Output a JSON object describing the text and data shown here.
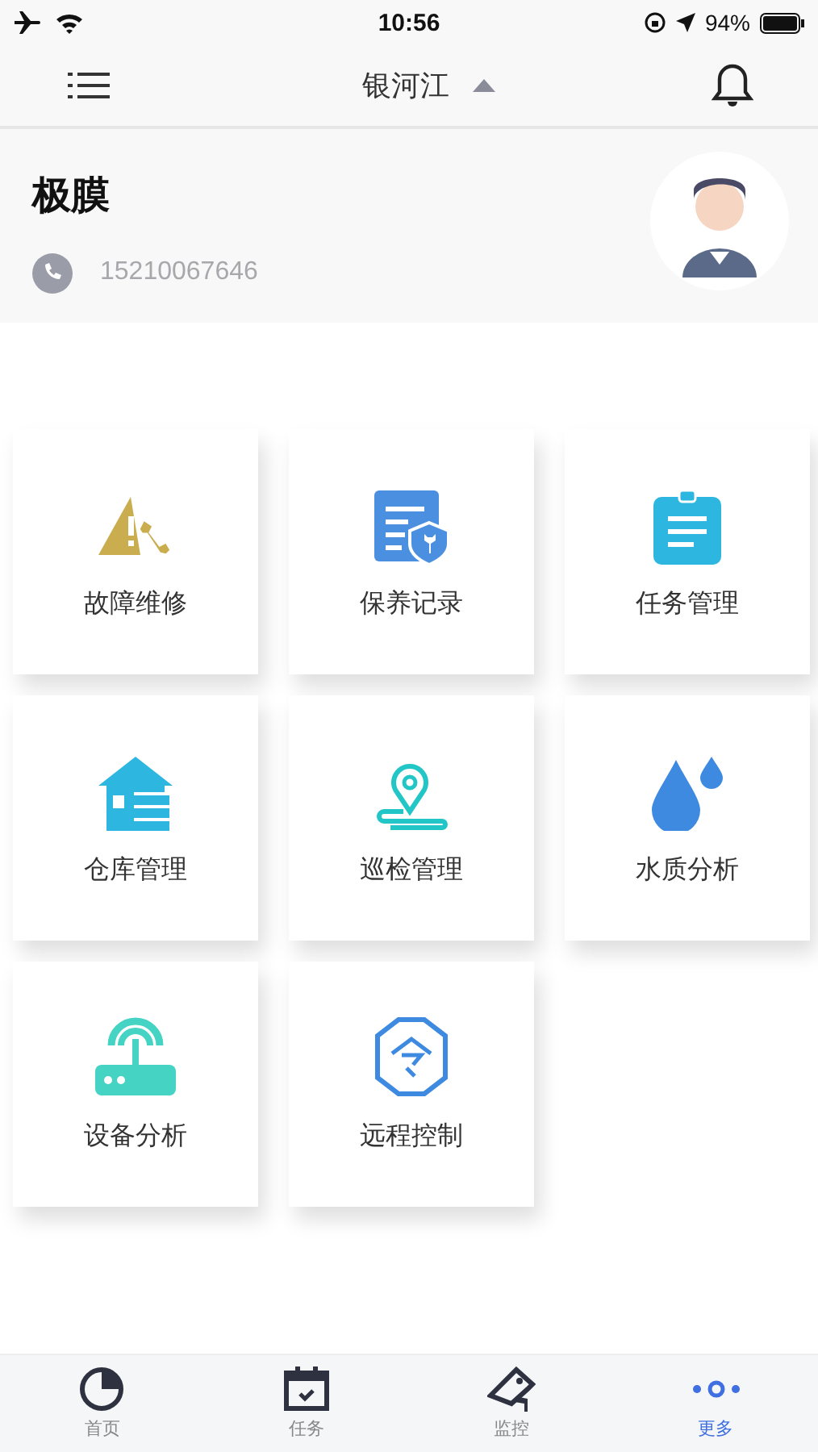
{
  "status_bar": {
    "time": "10:56",
    "battery": "94%"
  },
  "nav": {
    "title": "银河江"
  },
  "profile": {
    "name": "极膜",
    "phone": "15210067646"
  },
  "tiles": [
    {
      "label": "故障维修",
      "kind": "repair"
    },
    {
      "label": "保养记录",
      "kind": "maintenance"
    },
    {
      "label": "任务管理",
      "kind": "clipboard"
    },
    {
      "label": "仓库管理",
      "kind": "warehouse"
    },
    {
      "label": "巡检管理",
      "kind": "location"
    },
    {
      "label": "水质分析",
      "kind": "water"
    },
    {
      "label": "设备分析",
      "kind": "router"
    },
    {
      "label": "远程控制",
      "kind": "command"
    }
  ],
  "tab_bar": [
    {
      "label": "首页",
      "kind": "pie",
      "selected": false
    },
    {
      "label": "任务",
      "kind": "calendar",
      "selected": false
    },
    {
      "label": "监控",
      "kind": "camera",
      "selected": false
    },
    {
      "label": "更多",
      "kind": "more",
      "selected": true
    }
  ]
}
